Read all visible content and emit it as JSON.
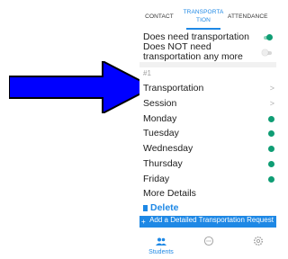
{
  "tabs": {
    "contact": "CONTACT",
    "transportation": "TRANSPORTATION",
    "attendance": "ATTENDANCE"
  },
  "transport_options": [
    {
      "label": "Does need transportation",
      "on": true
    },
    {
      "label": "Does NOT need transportation any more",
      "on": false
    }
  ],
  "section_label": "#1",
  "items": {
    "transportation": "Transportation",
    "session": "Session",
    "monday": "Monday",
    "tuesday": "Tuesday",
    "wednesday": "Wednesday",
    "thursday": "Thursday",
    "friday": "Friday",
    "more_details": "More Details"
  },
  "delete_label": "Delete",
  "add_request_label": "Add a Detailed Transportation Request",
  "bottom_nav": {
    "students_label": "Students"
  },
  "icons": [
    "arrow-icon",
    "chevron-right-icon",
    "trash-icon",
    "plus-icon",
    "students-icon",
    "chat-icon",
    "settings-icon"
  ],
  "colors": {
    "accent": "#1e88e5",
    "toggle_on": "#0f9d74",
    "arrow": "#0000ff"
  }
}
